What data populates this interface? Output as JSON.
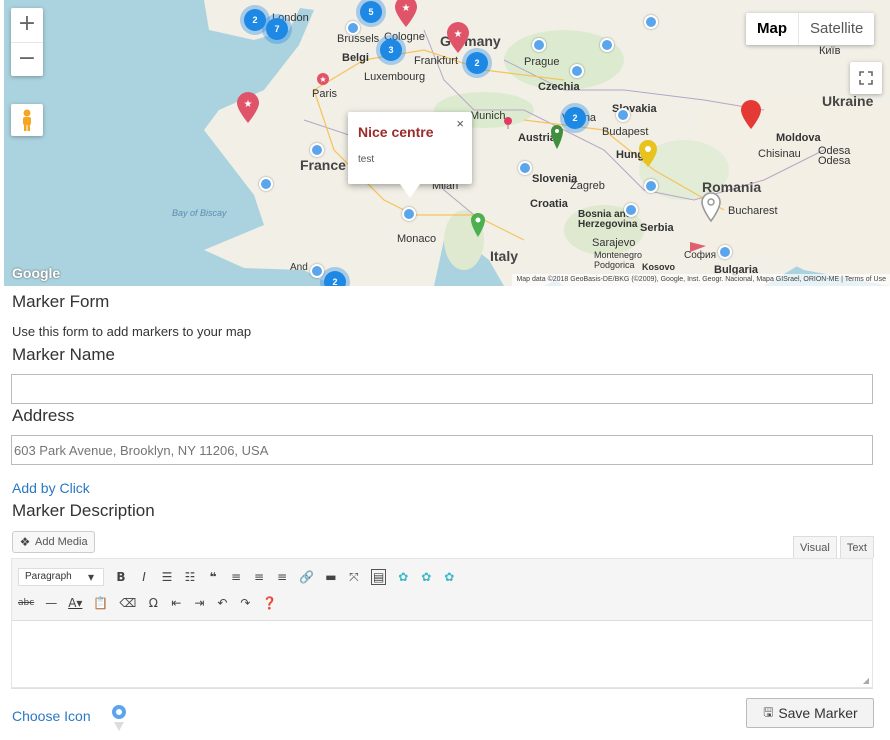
{
  "map": {
    "zoom_in": "+",
    "zoom_out": "−",
    "type_map": "Map",
    "type_satellite": "Satellite",
    "google_logo": "Google",
    "attribution": "Map data ©2018 GeoBasis-DE/BKG (©2009), Google, Inst. Geogr. Nacional, Mapa GISrael, ORION-ME | Terms of Use",
    "infowindow": {
      "title": "Nice centre",
      "text": "test",
      "close": "×"
    },
    "labels": {
      "germany": "Germany",
      "france": "France",
      "italy": "Italy",
      "romania": "Romania",
      "ukraine": "Ukraine",
      "prague": "Prague",
      "czechia": "Czechia",
      "frankfurt": "Frankfurt",
      "cologne": "Cologne",
      "brussels": "Brussels",
      "belgium": "Belgi",
      "luxembourg": "Luxembourg",
      "paris": "Paris",
      "munich": "Munich",
      "austria": "Austria",
      "vienna": "Vienna",
      "budapest": "Budapest",
      "hungary": "Hung",
      "slovakia": "Slovakia",
      "slovenia": "Slovenia",
      "zagreb": "Zagreb",
      "croatia": "Croatia",
      "bosnia": "Bosnia and Herzegovina",
      "sarajevo": "Sarajevo",
      "serbia": "Serbia",
      "bucharest": "Bucharest",
      "moldova": "Moldova",
      "chisinau": "Chisinau",
      "odesa": "Odesa Odesa",
      "kyiv": "Київ",
      "milan": "Milan",
      "monaco": "Monaco",
      "bay": "Bay of Biscay",
      "london": "London",
      "montenegro": "Montenegro",
      "podgorica": "Podgorica",
      "kosovo": "Kosovo",
      "sofia": "София",
      "bulgaria": "Bulgaria",
      "andorra": "And"
    },
    "clusters": [
      "2",
      "7",
      "5",
      "3",
      "2",
      "2",
      "2"
    ]
  },
  "form": {
    "title": "Marker Form",
    "description": "Use this form to add markers to your map",
    "name_label": "Marker Name",
    "name_value": "",
    "address_label": "Address",
    "address_placeholder": "603 Park Avenue, Brooklyn, NY 11206, USA",
    "add_by_click": "Add by Click",
    "desc_label": "Marker Description",
    "add_media": "Add Media",
    "tab_visual": "Visual",
    "tab_text": "Text",
    "format_select": "Paragraph",
    "choose_icon": "Choose Icon",
    "save_button": "Save Marker"
  }
}
